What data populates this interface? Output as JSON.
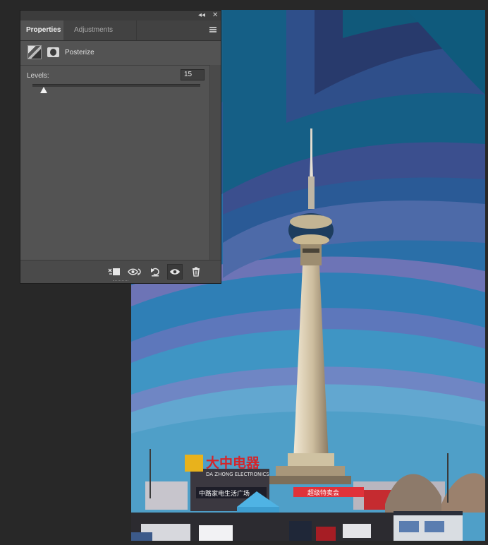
{
  "panel": {
    "tabs": [
      {
        "label": "Properties",
        "active": true
      },
      {
        "label": "Adjustments",
        "active": false
      }
    ],
    "collapse_glyph": "◂◂",
    "close_glyph": "✕",
    "adjustment": {
      "label": "Posterize",
      "icon": "posterize-icon",
      "mask_icon": "layer-mask-icon"
    },
    "levels": {
      "label": "Levels:",
      "value": "15",
      "fraction": 0.03
    },
    "footer_buttons": [
      {
        "name": "clip-to-layer-button",
        "icon": "clip-to-layer-icon"
      },
      {
        "name": "view-previous-state-button",
        "icon": "view-previous-state-icon"
      },
      {
        "name": "reset-adjustment-button",
        "icon": "reset-icon"
      },
      {
        "name": "toggle-visibility-button",
        "icon": "eye-icon"
      },
      {
        "name": "delete-adjustment-button",
        "icon": "trash-icon"
      }
    ]
  },
  "canvas": {
    "image": "posterized-photo-of-tv-tower",
    "sign_primary": "大中电器",
    "sign_secondary": "DA ZHONG ELECTRONICS",
    "store_sign": "中路家电生活广场",
    "banner_text": "超级特卖会",
    "colors": {
      "sky_dark": "#283a6c",
      "sky_band_teal": "#0f5a7c",
      "sky_band_violet": "#4d6aa8",
      "sky_light": "#4f9fc8",
      "tower": "#cbbb9c",
      "sign_yellow": "#e8b21c",
      "sign_red": "#d4252a"
    }
  },
  "colors": {
    "app_background": "#282828",
    "panel_background": "#535353",
    "panel_tabs": "#424242",
    "slider_thumb": "#f2f2f2"
  }
}
